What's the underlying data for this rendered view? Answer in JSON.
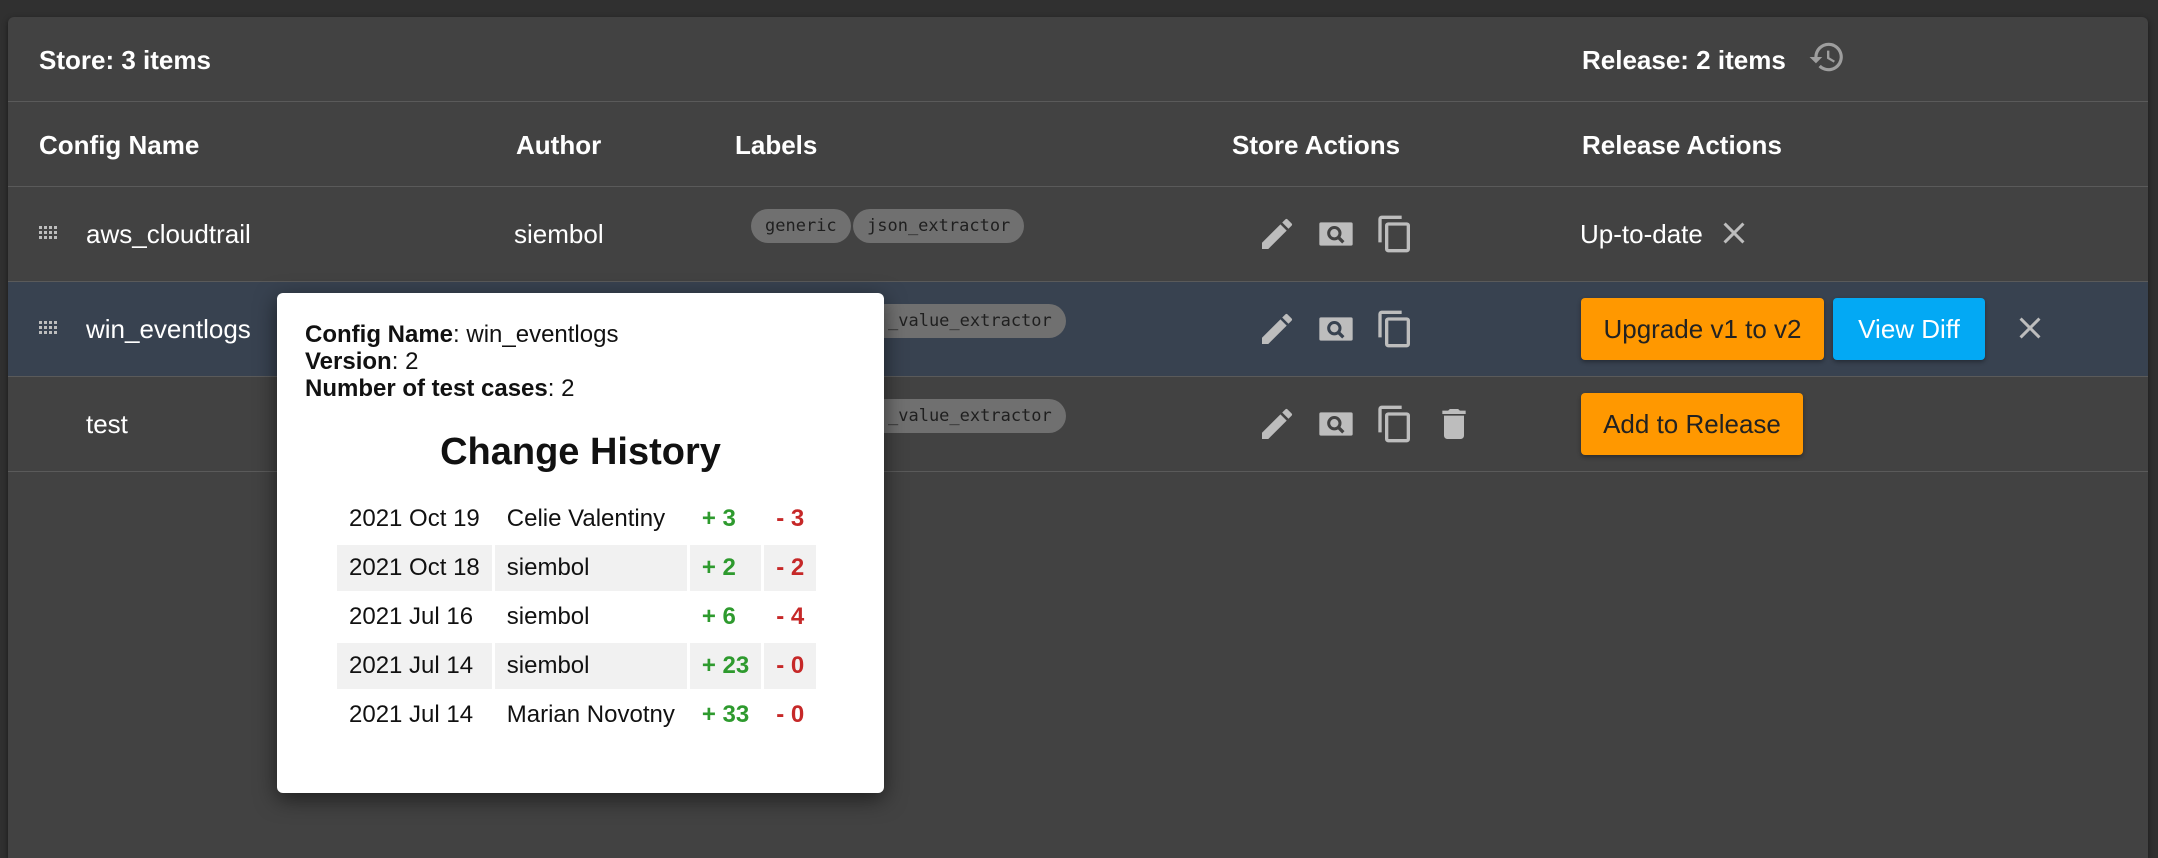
{
  "header": {
    "store_title": "Store: 3 items",
    "release_title": "Release: 2 items",
    "history_icon": "history-icon"
  },
  "columns": [
    "Config Name",
    "Author",
    "Labels",
    "Store Actions",
    "Release Actions"
  ],
  "rows": [
    {
      "name": "aws_cloudtrail",
      "author": "siembol",
      "labels": [
        "generic",
        "json_extractor"
      ],
      "store_actions": [
        "edit-icon",
        "search-icon",
        "copy-icon"
      ],
      "release_status": "Up-to-date"
    },
    {
      "name": "win_eventlogs",
      "author": "",
      "labels": [
        "_value_extractor"
      ],
      "store_actions": [
        "edit-icon",
        "search-icon",
        "copy-icon"
      ],
      "release_buttons": [
        "Upgrade v1 to v2",
        "View Diff"
      ]
    },
    {
      "name": "test",
      "author": "",
      "labels": [
        "_value_extractor"
      ],
      "store_actions": [
        "edit-icon",
        "search-icon",
        "copy-icon",
        "delete-icon"
      ],
      "release_buttons": [
        "Add to Release"
      ]
    }
  ],
  "popup": {
    "config_name_label": "Config Name",
    "config_name": "win_eventlogs",
    "version_label": "Version",
    "version": "2",
    "test_cases_label": "Number of test cases",
    "test_cases": "2",
    "title": "Change History",
    "history": [
      {
        "date": "2021 Oct 19",
        "author": "Celie Valentiny",
        "added": "+ 3",
        "removed": "- 3"
      },
      {
        "date": "2021 Oct 18",
        "author": "siembol",
        "added": "+ 2",
        "removed": "- 2"
      },
      {
        "date": "2021 Jul 16",
        "author": "siembol",
        "added": "+ 6",
        "removed": "- 4"
      },
      {
        "date": "2021 Jul 14",
        "author": "siembol",
        "added": "+ 23",
        "removed": "- 0"
      },
      {
        "date": "2021 Jul 14",
        "author": "Marian Novotny",
        "added": "+ 33",
        "removed": "- 0"
      }
    ]
  },
  "colors": {
    "background": "#303030",
    "panel": "#424242",
    "selected_row": "#384250",
    "orange_button": "#ff9800",
    "blue_button": "#03a9f4",
    "added": "#2e9a2e",
    "removed": "#c62828"
  }
}
